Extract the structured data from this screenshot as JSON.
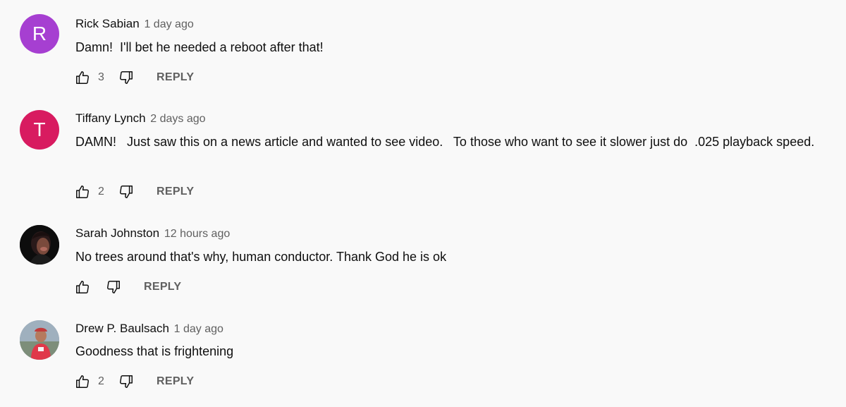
{
  "labels": {
    "reply": "REPLY"
  },
  "comments": [
    {
      "avatar": {
        "letter": "R",
        "color": "#a63fd1"
      },
      "author": "Rick Sabian",
      "time": "1 day ago",
      "text": "Damn!  I'll bet he needed a reboot after that!",
      "likes": "3"
    },
    {
      "avatar": {
        "letter": "T",
        "color": "#d81b60"
      },
      "author": "Tiffany Lynch",
      "time": "2 days ago",
      "text": "DAMN!   Just saw this on a news article and wanted to see video.   To those who want to see it slower just do  .025 playback speed.",
      "likes": "2"
    },
    {
      "avatar": {
        "letter": "",
        "color": "#111111"
      },
      "author": "Sarah Johnston",
      "time": "12 hours ago",
      "text": "No trees around that's why, human conductor. Thank God he is ok",
      "likes": ""
    },
    {
      "avatar": {
        "letter": "",
        "color": "#8a9aa8"
      },
      "author": "Drew P. Baulsach",
      "time": "1 day ago",
      "text": "Goodness that is frightening",
      "likes": "2"
    }
  ]
}
